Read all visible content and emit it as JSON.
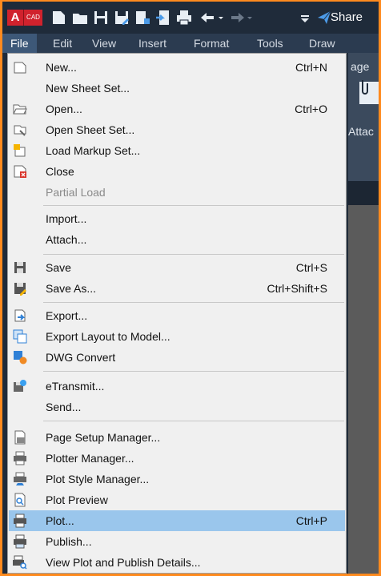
{
  "app": {
    "logo_letter": "A",
    "logo_sub": "CAD",
    "share_label": "Share"
  },
  "menubar": [
    "File",
    "Edit",
    "View",
    "Insert",
    "Format",
    "Tools",
    "Draw"
  ],
  "background": {
    "tab_fragment": "age",
    "attach_fragment": "Attac"
  },
  "menu": {
    "new": {
      "label": "New...",
      "shortcut": "Ctrl+N"
    },
    "new_sheet_set": {
      "label": "New Sheet Set..."
    },
    "open": {
      "label": "Open...",
      "shortcut": "Ctrl+O"
    },
    "open_sheet_set": {
      "label": "Open Sheet Set..."
    },
    "load_markup_set": {
      "label": "Load Markup Set..."
    },
    "close": {
      "label": "Close"
    },
    "partial_load": {
      "label": "Partial Load"
    },
    "import": {
      "label": "Import..."
    },
    "attach": {
      "label": "Attach..."
    },
    "save": {
      "label": "Save",
      "shortcut": "Ctrl+S"
    },
    "save_as": {
      "label": "Save As...",
      "shortcut": "Ctrl+Shift+S"
    },
    "export": {
      "label": "Export..."
    },
    "export_layout": {
      "label": "Export Layout to Model..."
    },
    "dwg_convert": {
      "label": "DWG Convert"
    },
    "etransmit": {
      "label": "eTransmit..."
    },
    "send": {
      "label": "Send..."
    },
    "page_setup": {
      "label": "Page Setup Manager..."
    },
    "plotter_manager": {
      "label": "Plotter Manager..."
    },
    "plot_style_manager": {
      "label": "Plot Style Manager..."
    },
    "plot_preview": {
      "label": "Plot Preview"
    },
    "plot": {
      "label": "Plot...",
      "shortcut": "Ctrl+P"
    },
    "publish": {
      "label": "Publish..."
    },
    "view_plot_details": {
      "label": "View Plot and Publish Details..."
    }
  },
  "colors": {
    "highlight": "#9ac6ec",
    "frame": "#ff8a1e",
    "titlebar": "#1f2b3a",
    "menubar": "#2b3b50"
  }
}
